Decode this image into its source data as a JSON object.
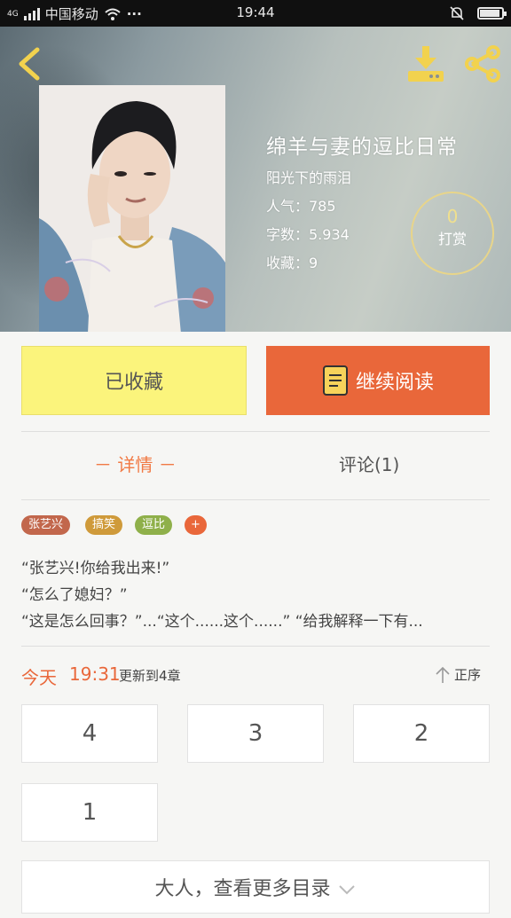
{
  "status_bar": {
    "signal_label": "4G",
    "carrier": "中国移动",
    "dots": "···",
    "time": "19:44",
    "battery_level": 0.9
  },
  "book": {
    "title": "绵羊与妻的逗比日常",
    "author": "阳光下的雨泪",
    "popularity": "人气：785",
    "word_count": "字数：5.934",
    "favorites": "收藏：9",
    "tip_count": "0",
    "tip_label": "打赏"
  },
  "actions": {
    "favorite_label": "已收藏",
    "continue_label": "继续阅读"
  },
  "tabs": {
    "detail": "－ 详情 －",
    "comment": "评论(1)"
  },
  "tags": [
    {
      "label": "张艺兴",
      "color": "#c2674c"
    },
    {
      "label": "搞笑",
      "color": "#cf9a3a"
    },
    {
      "label": "逗比",
      "color": "#8fb04a"
    },
    {
      "label": "+",
      "color": "#e9673a"
    }
  ],
  "description": [
    "“张艺兴!你给我出来!”",
    "“怎么了媳妇？”",
    "“这是怎么回事？”...“这个......这个......” “给我解释一下有..."
  ],
  "update": {
    "day": "今天",
    "time": "19:31",
    "text": "更新到4章",
    "sort_label": "正序"
  },
  "chapters": [
    "4",
    "3",
    "2",
    "1"
  ],
  "more_label": "大人，查看更多目录",
  "colors": {
    "accent": "#e9673a",
    "favorite_bg": "#fbf47c",
    "icon_yellow": "#f2d24e"
  }
}
